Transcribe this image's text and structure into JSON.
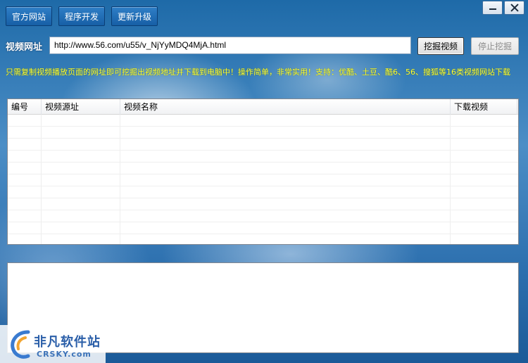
{
  "toolbar": {
    "official_site": "官方网站",
    "program_dev": "程序开发",
    "update": "更新升级"
  },
  "window_controls": {
    "minimize": "minimize-icon",
    "close": "close-icon"
  },
  "url_bar": {
    "label": "视频网址",
    "value": "http://www.56.com/u55/v_NjYyMDQ4MjA.html",
    "dig_button": "挖掘视频",
    "stop_button": "停止挖掘"
  },
  "notice": "只需复制视频播放页面的网址即可挖掘出视频地址并下载到电脑中！操作简单，非常实用！支持：优酷、土豆、酷6、56、搜狐等16类视频网站下载",
  "table": {
    "columns": [
      "编号",
      "视频源址",
      "视频名称",
      "下载视频"
    ],
    "rows": []
  },
  "log": "",
  "watermark": {
    "main": "非凡软件站",
    "sub": "CRSKY.com"
  },
  "colors": {
    "notice_text": "#ffff3a",
    "toolbar_button": "#1d68b0"
  }
}
